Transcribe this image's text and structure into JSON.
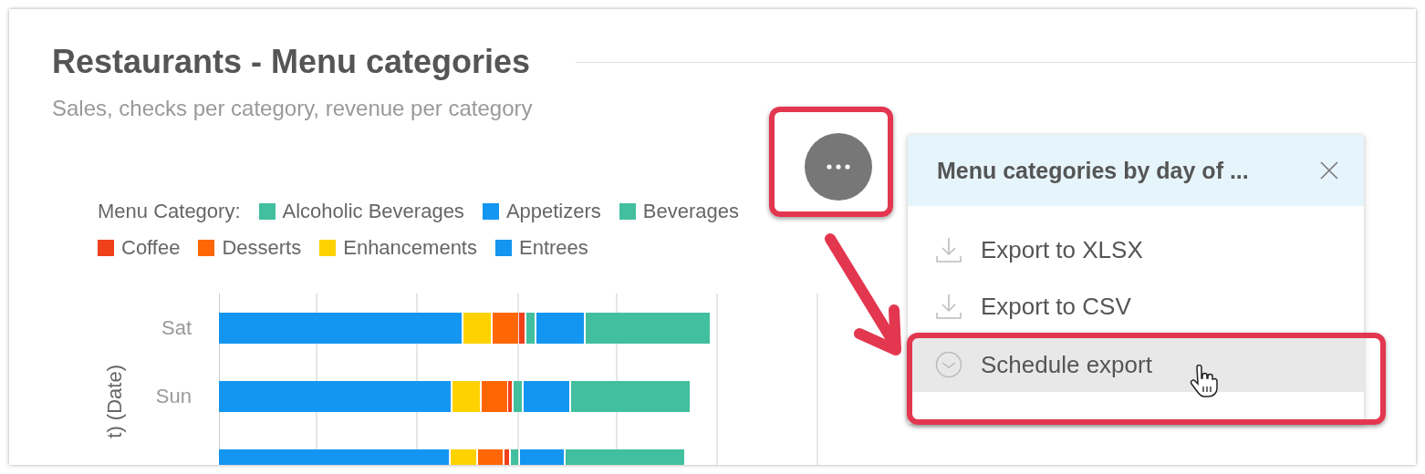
{
  "header": {
    "title": "Restaurants - Menu categories",
    "subtitle": "Sales, checks per category, revenue per category"
  },
  "chart": {
    "legend": {
      "title": "Menu Category:",
      "items": [
        {
          "label": "Alcoholic Beverages",
          "color": "#42bf9e"
        },
        {
          "label": "Appetizers",
          "color": "#1396f1"
        },
        {
          "label": "Beverages",
          "color": "#42bf9e"
        },
        {
          "label": "Coffee",
          "color": "#f0401a"
        },
        {
          "label": "Desserts",
          "color": "#ff6605"
        },
        {
          "label": "Enhancements",
          "color": "#fdd200"
        },
        {
          "label": "Entrees",
          "color": "#1396f1"
        }
      ]
    },
    "axis_label": "t) (Date)",
    "categories": [
      "Sat",
      "Sun"
    ]
  },
  "menu": {
    "title": "Menu categories by day of ...",
    "items": [
      {
        "label": "Export to XLSX",
        "kind": "download",
        "selected": false
      },
      {
        "label": "Export to CSV",
        "kind": "download",
        "selected": false
      },
      {
        "label": "Schedule export",
        "kind": "schedule",
        "selected": true
      }
    ]
  }
}
